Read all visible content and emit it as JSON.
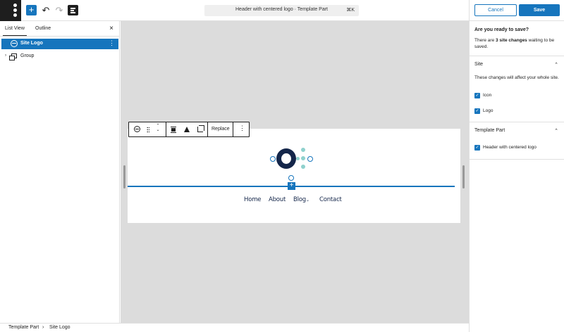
{
  "topbar": {
    "add_label": "+",
    "undo_label": "↶",
    "redo_label": "↷",
    "document_title": "Header with centered logo · Template Part",
    "shortcut": "⌘K"
  },
  "left_panel": {
    "tabs": [
      "List View",
      "Outline"
    ],
    "close_label": "×",
    "items": [
      {
        "label": "Site Logo",
        "selected": true
      },
      {
        "label": "Group",
        "selected": false
      }
    ],
    "more_label": "⋮",
    "chevron": "›"
  },
  "block_toolbar": {
    "move_up": "⌃",
    "move_down": "⌄",
    "replace_label": "Replace",
    "more_label": "⋮"
  },
  "canvas": {
    "inserter_label": "+",
    "nav_items": [
      "Home",
      "About",
      "Blog",
      "Contact"
    ],
    "blog_submenu_indicator": "⌄"
  },
  "save_panel": {
    "cancel_label": "Cancel",
    "save_label": "Save",
    "question": "Are you ready to save?",
    "message_prefix": "There are ",
    "message_count": "3 site changes",
    "message_suffix": " waiting to be saved.",
    "sections": [
      {
        "title": "Site",
        "description": "These changes will affect your whole site.",
        "items": [
          {
            "label": "Icon",
            "checked": true
          },
          {
            "label": "Logo",
            "checked": true
          }
        ]
      },
      {
        "title": "Template Part",
        "description": "",
        "items": [
          {
            "label": "Header with centered logo",
            "checked": true
          }
        ]
      }
    ],
    "chevron_up": "⌃",
    "check_mark": "✓"
  },
  "breadcrumb": {
    "items": [
      "Template Part",
      "Site Logo"
    ],
    "separator": "›"
  },
  "colors": {
    "accent": "#1675bd",
    "logo_dark": "#14264a",
    "logo_teal": "#8fd1cd",
    "canvas_bg": "#dcdcdc"
  }
}
